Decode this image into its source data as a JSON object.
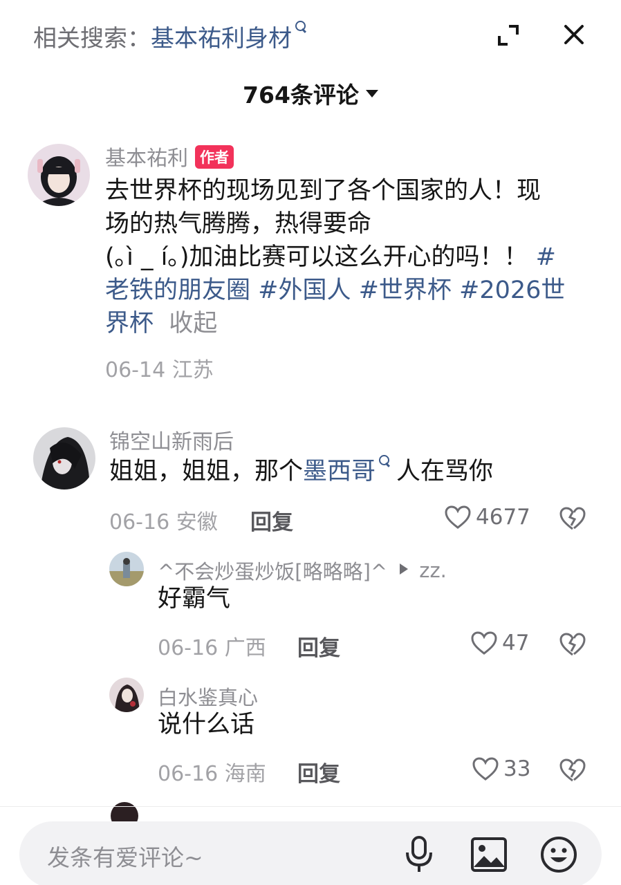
{
  "search": {
    "prefix": "相关搜索：",
    "term": "基本祐利身材"
  },
  "header": {
    "count_label": "764条评论"
  },
  "author_post": {
    "name": "基本祐利",
    "badge": "作者",
    "text_line1": "去世界杯的现场见到了各个国家的人！现",
    "text_line2": "场的热气腾腾，热得要命",
    "text_line3": "(｡ì _ í｡)加油比赛可以这么开心的吗！！",
    "hashtag_start": "#",
    "text_line4": "老铁的朋友圈 #外国人 #世界杯 #2026世",
    "text_line5": "界杯",
    "collapse": "收起",
    "meta": "06-14 江苏"
  },
  "comments": [
    {
      "name": "锦空山新雨后",
      "text_before": "姐姐，姐姐，那个",
      "text_link": "墨西哥",
      "text_after": "人在骂你",
      "meta": "06-16 安徽",
      "reply": "回复",
      "likes": "4677"
    }
  ],
  "replies": [
    {
      "name": "^不会炒蛋炒饭[略略略]^",
      "reply_to": "zz.",
      "text": "好霸气",
      "meta": "06-16 广西",
      "reply": "回复",
      "likes": "47"
    },
    {
      "name": "白水鉴真心",
      "text": "说什么话",
      "meta": "06-16 海南",
      "reply": "回复",
      "likes": "33"
    }
  ],
  "input": {
    "placeholder": "发条有爱评论~"
  },
  "colors": {
    "link": "#3c5a8a",
    "badge": "#f2325a",
    "secondary": "#8e8e93"
  }
}
